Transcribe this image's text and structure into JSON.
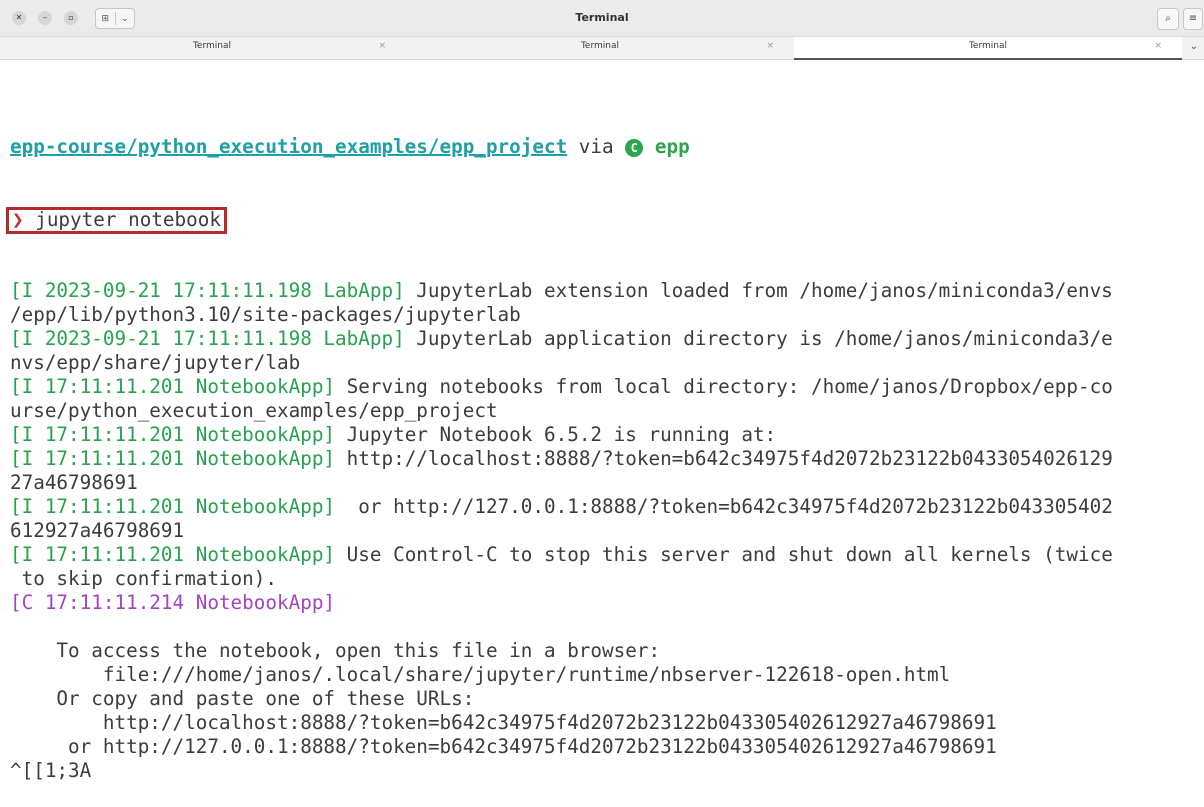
{
  "window": {
    "title": "Terminal",
    "tabs": [
      {
        "label": "Terminal",
        "close": "×",
        "active": false
      },
      {
        "label": "Terminal",
        "close": "×",
        "active": false
      },
      {
        "label": "Terminal",
        "close": "×",
        "active": true
      }
    ]
  },
  "prompt": {
    "path": "epp-course/python_execution_examples/epp_project",
    "via": " via ",
    "env_icon": "C",
    "env": "epp",
    "chevron": "❯",
    "command": " jupyter notebook"
  },
  "output": [
    {
      "tag": "[I 2023-09-21 17:11:11.198 LabApp]",
      "kind": "info",
      "text": " JupyterLab extension loaded from /home/janos/miniconda3/envs"
    },
    {
      "tag": "",
      "kind": "plain",
      "text": "/epp/lib/python3.10/site-packages/jupyterlab"
    },
    {
      "tag": "[I 2023-09-21 17:11:11.198 LabApp]",
      "kind": "info",
      "text": " JupyterLab application directory is /home/janos/miniconda3/e"
    },
    {
      "tag": "",
      "kind": "plain",
      "text": "nvs/epp/share/jupyter/lab"
    },
    {
      "tag": "[I 17:11:11.201 NotebookApp]",
      "kind": "info",
      "text": " Serving notebooks from local directory: /home/janos/Dropbox/epp-co"
    },
    {
      "tag": "",
      "kind": "plain",
      "text": "urse/python_execution_examples/epp_project"
    },
    {
      "tag": "[I 17:11:11.201 NotebookApp]",
      "kind": "info",
      "text": " Jupyter Notebook 6.5.2 is running at:"
    },
    {
      "tag": "[I 17:11:11.201 NotebookApp]",
      "kind": "info",
      "text": " http://localhost:8888/?token=b642c34975f4d2072b23122b0433054026129"
    },
    {
      "tag": "",
      "kind": "plain",
      "text": "27a46798691"
    },
    {
      "tag": "[I 17:11:11.201 NotebookApp]",
      "kind": "info",
      "text": "  or http://127.0.0.1:8888/?token=b642c34975f4d2072b23122b043305402"
    },
    {
      "tag": "",
      "kind": "plain",
      "text": "612927a46798691"
    },
    {
      "tag": "[I 17:11:11.201 NotebookApp]",
      "kind": "info",
      "text": " Use Control-C to stop this server and shut down all kernels (twice"
    },
    {
      "tag": "",
      "kind": "plain",
      "text": " to skip confirmation)."
    },
    {
      "tag": "[C 17:11:11.214 NotebookApp]",
      "kind": "critical",
      "text": ""
    },
    {
      "tag": "",
      "kind": "plain",
      "text": ""
    },
    {
      "tag": "",
      "kind": "plain",
      "text": "    To access the notebook, open this file in a browser:"
    },
    {
      "tag": "",
      "kind": "plain",
      "text": "        file:///home/janos/.local/share/jupyter/runtime/nbserver-122618-open.html"
    },
    {
      "tag": "",
      "kind": "plain",
      "text": "    Or copy and paste one of these URLs:"
    },
    {
      "tag": "",
      "kind": "plain",
      "text": "        http://localhost:8888/?token=b642c34975f4d2072b23122b043305402612927a46798691"
    },
    {
      "tag": "",
      "kind": "plain",
      "text": "     or http://127.0.0.1:8888/?token=b642c34975f4d2072b23122b043305402612927a46798691"
    },
    {
      "tag": "",
      "kind": "plain",
      "text": "^[[1;3A"
    }
  ],
  "colors": {
    "path": "#1f9fa6",
    "env": "#2ea44f",
    "info_tag": "#27a24f",
    "critical_tag": "#a244c2",
    "highlight_box": "#b52b2b"
  }
}
